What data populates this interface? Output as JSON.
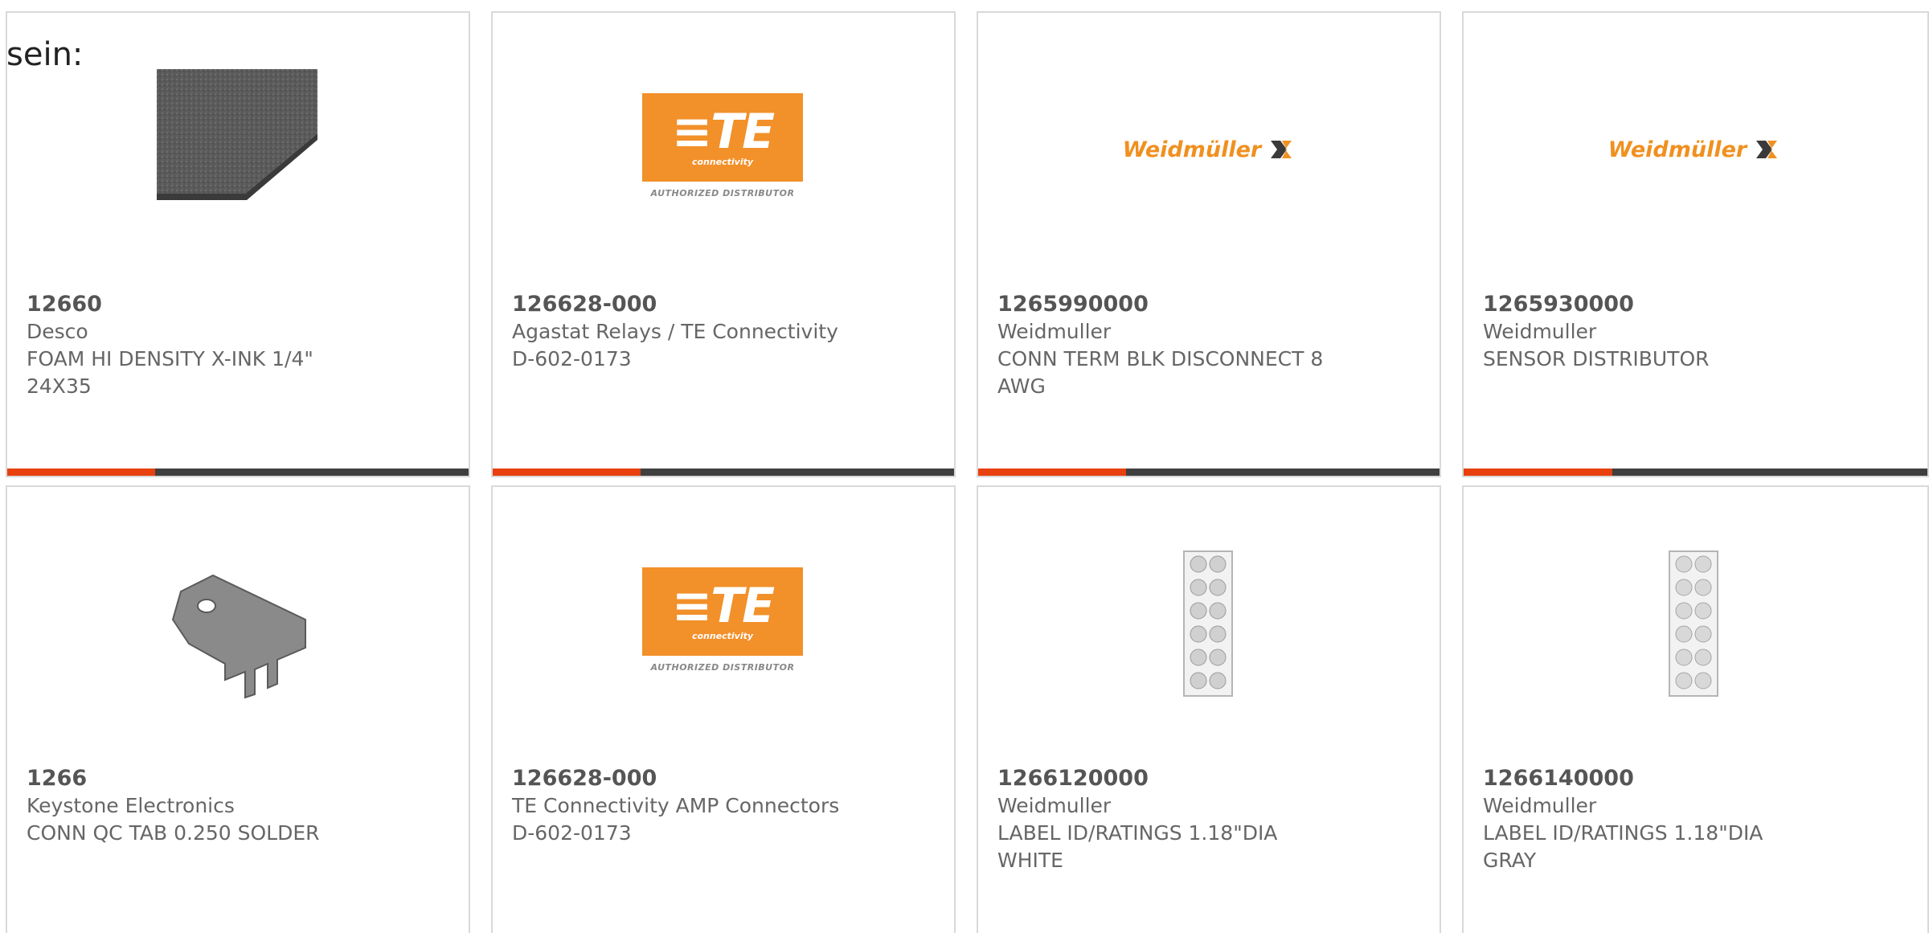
{
  "intro_text": "sein:",
  "colors": {
    "accent": "#e8400f",
    "bar": "#3f3f3f",
    "te_orange": "#f2902a",
    "weidmuller_orange": "#f09020"
  },
  "logos": {
    "te_mark": "≡TE",
    "te_sub": "connectivity",
    "te_dist": "AUTHORIZED DISTRIBUTOR",
    "weidmuller": "Weidmüller"
  },
  "products": [
    {
      "part_number": "12660",
      "manufacturer": "Desco",
      "description": "FOAM HI DENSITY X-INK 1/4\" 24X35",
      "image": "foam-sheet"
    },
    {
      "part_number": "126628-000",
      "manufacturer": "Agastat Relays / TE Connectivity",
      "description": "D-602-0173",
      "image": "te-logo"
    },
    {
      "part_number": "1265990000",
      "manufacturer": "Weidmuller",
      "description": "CONN TERM BLK DISCONNECT 8 AWG",
      "image": "weidmuller-logo"
    },
    {
      "part_number": "1265930000",
      "manufacturer": "Weidmuller",
      "description": "SENSOR DISTRIBUTOR",
      "image": "weidmuller-logo"
    },
    {
      "part_number": "1266",
      "manufacturer": "Keystone Electronics",
      "description": "CONN QC TAB 0.250 SOLDER",
      "image": "qc-tab"
    },
    {
      "part_number": "126628-000",
      "manufacturer": "TE Connectivity AMP Connectors",
      "description": "D-602-0173",
      "image": "te-logo"
    },
    {
      "part_number": "1266120000",
      "manufacturer": "Weidmuller",
      "description": "LABEL ID/RATINGS 1.18\"DIA WHITE",
      "image": "label-sheet"
    },
    {
      "part_number": "1266140000",
      "manufacturer": "Weidmuller",
      "description": "LABEL ID/RATINGS 1.18\"DIA GRAY",
      "image": "label-sheet"
    }
  ]
}
